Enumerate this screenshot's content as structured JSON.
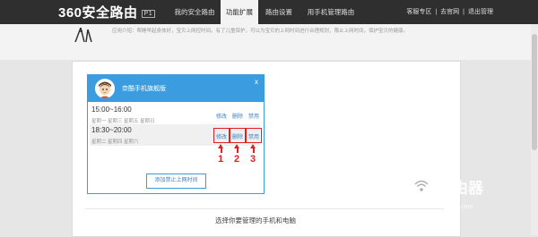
{
  "app": {
    "logo": "360安全路由",
    "model": "P1"
  },
  "nav": {
    "items": [
      "我的安全路由",
      "功能扩展",
      "路由设置",
      "用手机管理路由"
    ],
    "active_index": 1
  },
  "top_links": {
    "zone": "客服专区",
    "site": "去官网",
    "logout": "退出管理",
    "sep": "|"
  },
  "description": "应用介绍：帮睡早起身体好，宝贝上网控时间。有了儿童保护，可以为宝贝的上网时间进行合理规划，限止上网时间，保护宝贝的健康。",
  "dialog": {
    "title": "奈酷手机旗舰版",
    "close": "x",
    "rules": [
      {
        "time": "15:00~16:00",
        "days": "星期一 星期三 星期五 星期日",
        "edit": "修改",
        "delete": "删除",
        "disable": "禁用"
      },
      {
        "time": "18:30~20:00",
        "days": "星期二 星期四 星期六",
        "edit": "修改",
        "delete": "删除",
        "disable": "禁用"
      }
    ],
    "add_button": "添加禁止上网时间"
  },
  "annotations": [
    "1",
    "2",
    "3"
  ],
  "footer": {
    "text": "选择你要管理的手机和电脑"
  },
  "watermark": {
    "title": "路由器",
    "url": "luyouqi.com"
  },
  "colors": {
    "accent": "#3b9de0",
    "annotation": "#e02020",
    "topbar": "#2f2f2f"
  }
}
